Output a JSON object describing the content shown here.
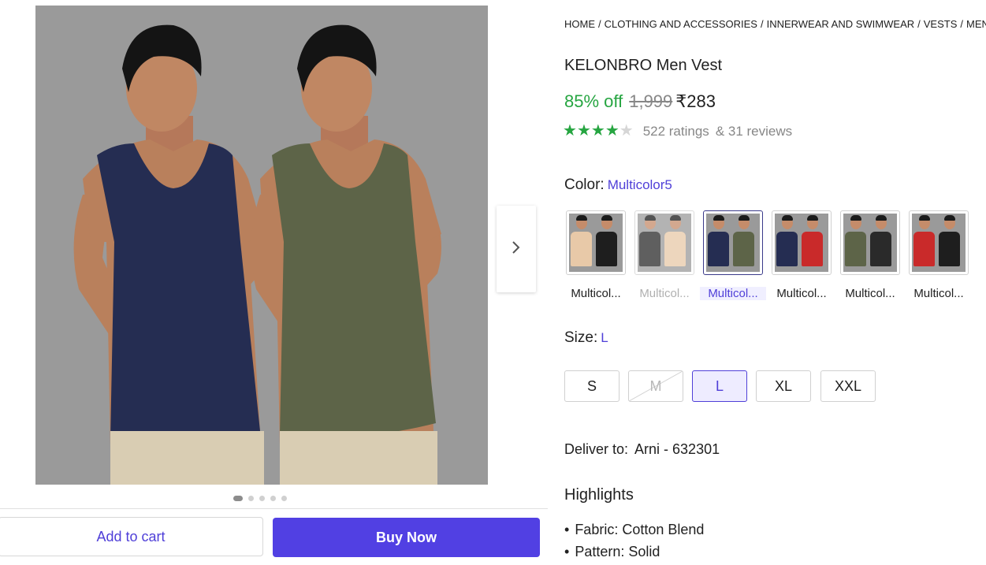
{
  "breadcrumb": [
    "HOME",
    "CLOTHING AND ACCESSORIES",
    "INNERWEAR AND SWIMWEAR",
    "VESTS",
    "MEN'S V"
  ],
  "product": {
    "title": "KELONBRO Men Vest",
    "discount": "85% off",
    "mrp": "1,999",
    "price": "₹283",
    "rating_stars": 4,
    "ratings_text": "522 ratings",
    "reviews_text": "& 31 reviews"
  },
  "color": {
    "label": "Color:",
    "selected": "Multicolor5",
    "options": [
      {
        "label": "Multicol...",
        "state": "normal",
        "left": "#e8c9a8",
        "right": "#1e1e1e"
      },
      {
        "label": "Multicol...",
        "state": "disabled",
        "left": "#2a2a2a",
        "right": "#e8c9a8"
      },
      {
        "label": "Multicol...",
        "state": "selected",
        "left": "#252d52",
        "right": "#5d6448"
      },
      {
        "label": "Multicol...",
        "state": "normal",
        "left": "#252d52",
        "right": "#c92a2a"
      },
      {
        "label": "Multicol...",
        "state": "normal",
        "left": "#5d6448",
        "right": "#2a2a2a"
      },
      {
        "label": "Multicol...",
        "state": "normal",
        "left": "#c92a2a",
        "right": "#1e1e1e"
      }
    ]
  },
  "size": {
    "label": "Size:",
    "selected": "L",
    "options": [
      {
        "label": "S",
        "state": "normal"
      },
      {
        "label": "M",
        "state": "disabled"
      },
      {
        "label": "L",
        "state": "selected"
      },
      {
        "label": "XL",
        "state": "normal"
      },
      {
        "label": "XXL",
        "state": "normal"
      }
    ]
  },
  "delivery": {
    "label": "Deliver to:",
    "location": "Arni - 632301"
  },
  "highlights": {
    "title": "Highlights",
    "items": [
      "Fabric: Cotton Blend",
      "Pattern: Solid"
    ]
  },
  "gallery": {
    "image_count": 5,
    "active_index": 0,
    "vest_left_color": "#252d52",
    "vest_right_color": "#5d6448"
  },
  "actions": {
    "add_to_cart": "Add to cart",
    "buy_now": "Buy Now"
  }
}
